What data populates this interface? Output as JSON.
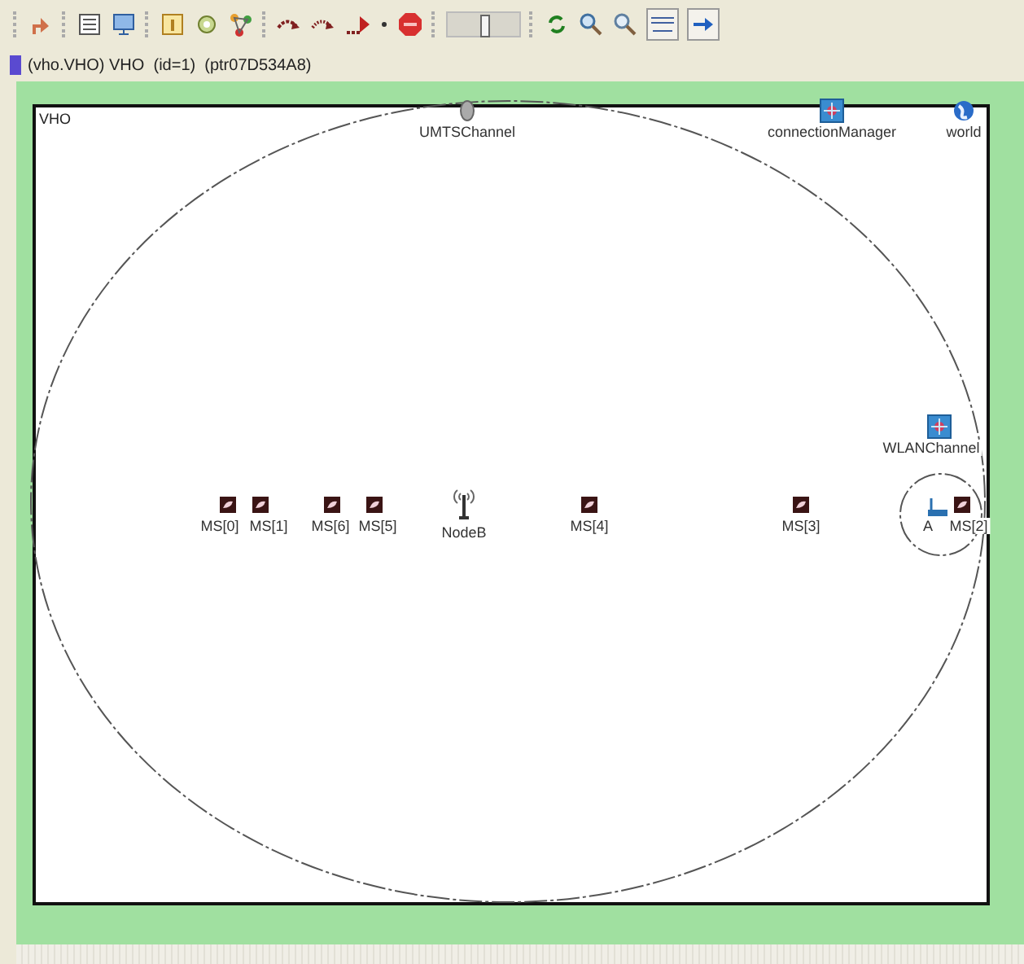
{
  "inspector": {
    "path": "(vho.VHO) VHO  (id=1)  (ptr07D534A8)"
  },
  "canvas": {
    "module_name": "VHO",
    "nodes": [
      {
        "name": "UMTSChannel",
        "kind": "channel"
      },
      {
        "name": "connectionManager",
        "kind": "manager"
      },
      {
        "name": "world",
        "kind": "world"
      },
      {
        "name": "WLANChannel",
        "kind": "wlan"
      },
      {
        "name": "MS[0]",
        "kind": "ms"
      },
      {
        "name": "MS[1]",
        "kind": "ms"
      },
      {
        "name": "MS[6]",
        "kind": "ms"
      },
      {
        "name": "MS[5]",
        "kind": "ms"
      },
      {
        "name": "NodeB",
        "kind": "nodeb"
      },
      {
        "name": "MS[4]",
        "kind": "ms"
      },
      {
        "name": "MS[3]",
        "kind": "ms"
      },
      {
        "name": "A",
        "kind": "ap"
      },
      {
        "name": "MS[2]",
        "kind": "ms"
      }
    ]
  }
}
